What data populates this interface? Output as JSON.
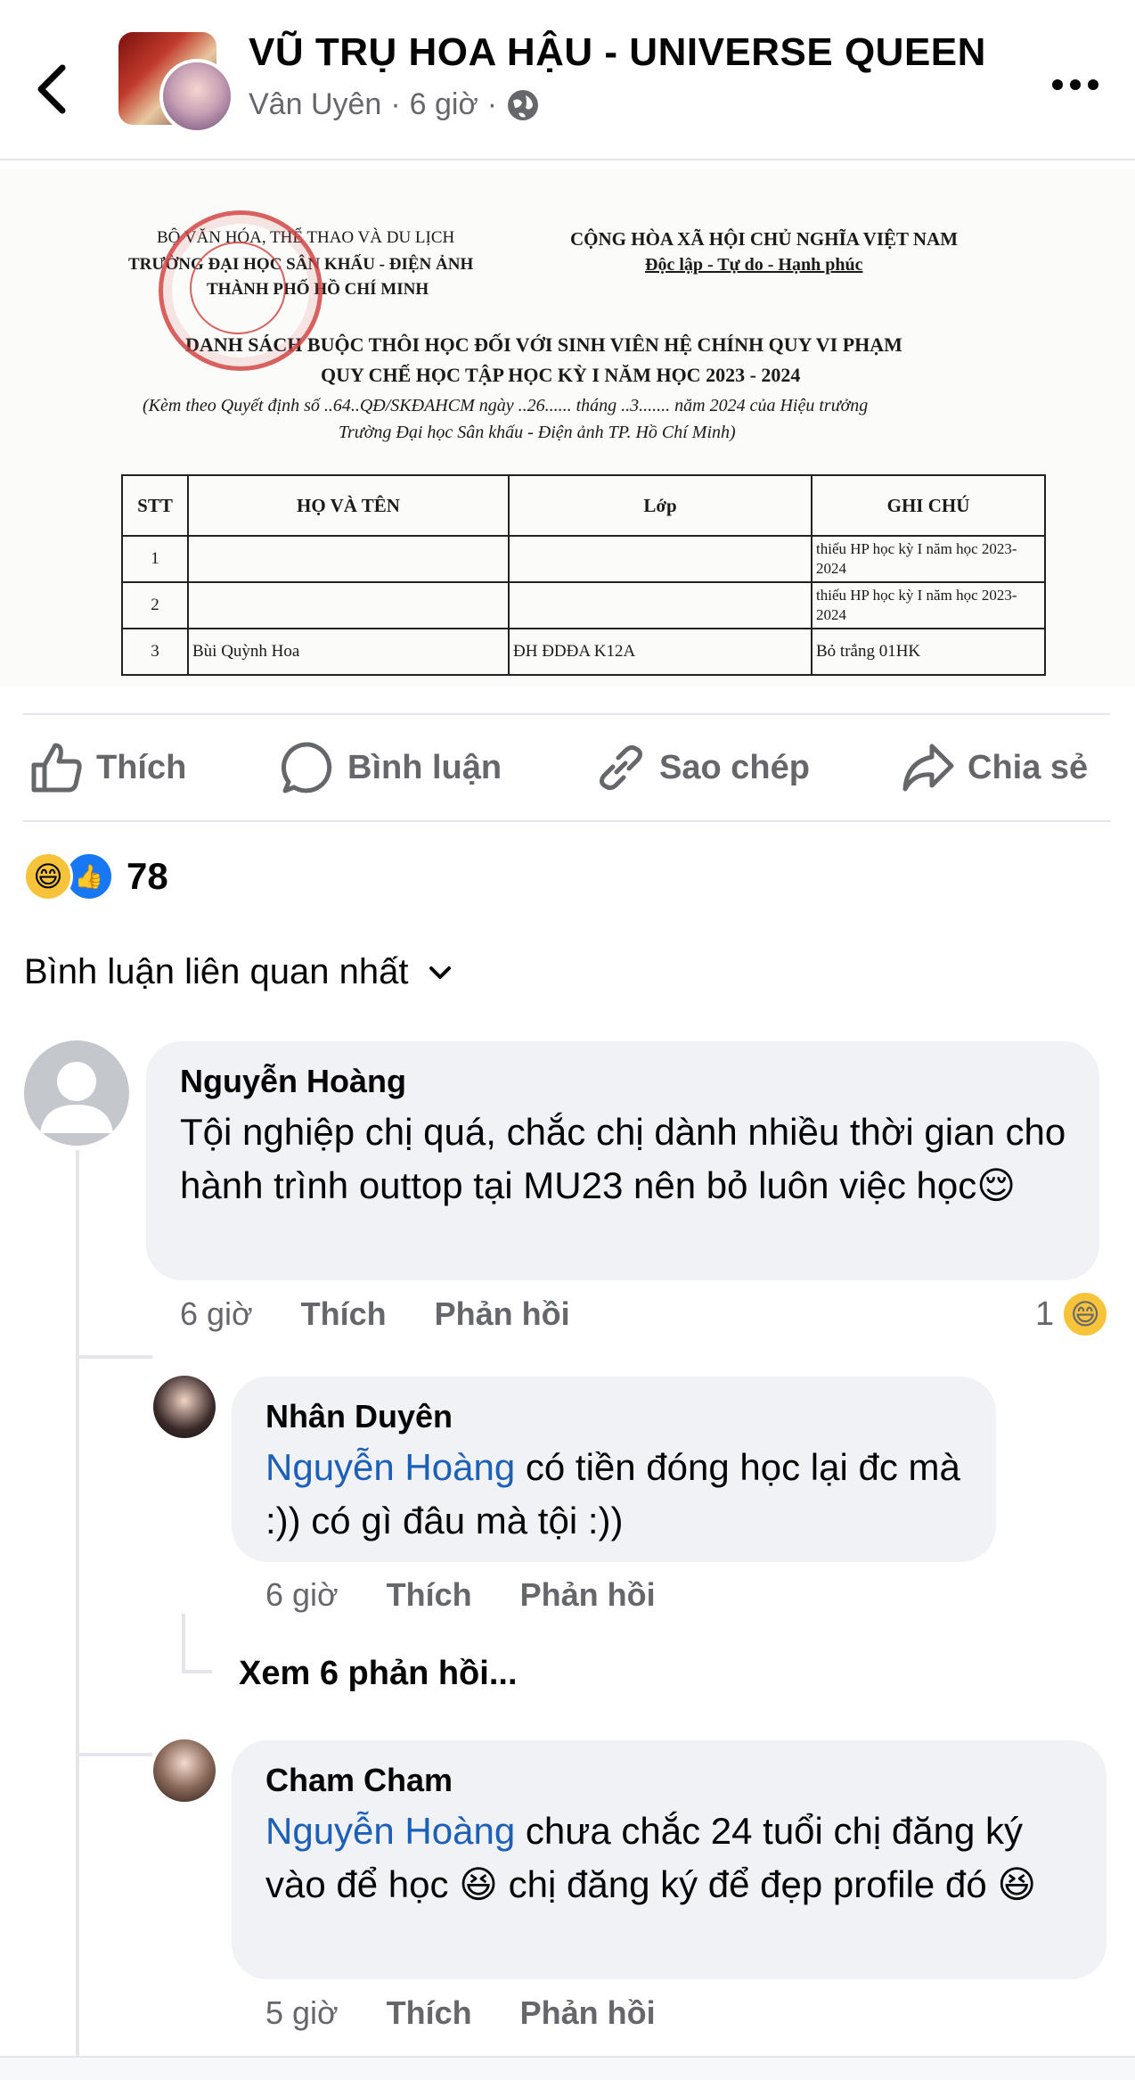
{
  "header": {
    "title": "VŨ TRỤ HOA HẬU - UNIVERSE QUEEN",
    "author": "Vân Uyên",
    "time": "6 giờ",
    "separator": "·"
  },
  "document": {
    "left_header": [
      "BỘ VĂN HÓA, THỂ THAO VÀ DU LỊCH",
      "TRƯỜNG ĐẠI HỌC SÂN KHẤU - ĐIỆN ẢNH",
      "THÀNH PHỐ HỒ CHÍ MINH"
    ],
    "right_header": [
      "CỘNG HÒA XÃ HỘI CHỦ NGHĨA VIỆT NAM",
      "Độc lập - Tự do - Hạnh phúc"
    ],
    "title_line1": "DANH SÁCH  BUỘC THÔI HỌC  ĐỐI VỚI SINH VIÊN HỆ CHÍNH QUY VI PHẠM",
    "title_line2": "QUY CHẾ HỌC TẬP HỌC KỲ I NĂM HỌC 2023 - 2024",
    "note_line1": "(Kèm theo Quyết định số ..64..QĐ/SKĐAHCM ngày ..26...... tháng ..3....... năm 2024 của Hiệu trưởng",
    "note_line2": "Trường Đại học Sân khấu - Điện ảnh TP. Hồ Chí Minh)",
    "table": {
      "headers": [
        "STT",
        "HỌ VÀ TÊN",
        "Lớp",
        "GHI CHÚ"
      ],
      "rows": [
        [
          "1",
          "",
          "",
          "thiếu HP học kỳ I năm học 2023-2024"
        ],
        [
          "2",
          "",
          "",
          "thiếu HP học kỳ I năm học 2023-2024"
        ],
        [
          "3",
          "Bùi Quỳnh Hoa",
          "ĐH ĐDĐA K12A",
          "Bỏ trắng 01HK"
        ]
      ]
    }
  },
  "actions": {
    "like": "Thích",
    "comment": "Bình luận",
    "copy": "Sao chép",
    "share": "Chia sẻ"
  },
  "reactions": {
    "count": "78",
    "emojis": [
      "😄",
      "👍"
    ]
  },
  "sort_label": "Bình luận liên quan nhất",
  "comments": [
    {
      "name": "Nguyễn Hoàng",
      "text": "Tội nghiệp chị quá, chắc chị dành nhiều thời gian cho hành trình outtop tại MU23 nên bỏ luôn việc học",
      "emoji": "😌",
      "time": "6 giờ",
      "like": "Thích",
      "reply": "Phản hồi",
      "reaction_count": "1",
      "reaction_emoji": "😄"
    },
    {
      "name": "Nhân Duyên",
      "mention": "Nguyễn Hoàng",
      "text": " có tiền đóng học lại đc mà :)) có gì đâu mà tội :))",
      "time": "6 giờ",
      "like": "Thích",
      "reply": "Phản hồi"
    },
    {
      "name": "Cham Cham",
      "mention": "Nguyễn Hoàng",
      "text1": " chưa chắc 24 tuổi chị đăng ký vào để học ",
      "emoji1": "😆",
      "text2": " chị đăng ký để đẹp profile đó ",
      "emoji2": "😆",
      "time": "5 giờ",
      "like": "Thích",
      "reply": "Phản hồi"
    }
  ],
  "view_replies": "Xem 6 phản hồi...",
  "colors": {
    "mention": "#1c5fb8",
    "secondary_text": "#65676b",
    "bubble": "#f0f2f5",
    "like_blue": "#1877f2"
  }
}
